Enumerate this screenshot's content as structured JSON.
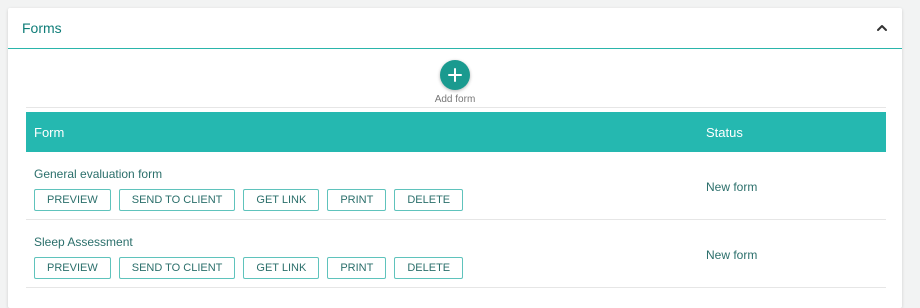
{
  "panel": {
    "title": "Forms"
  },
  "add_form": {
    "label": "Add form"
  },
  "table": {
    "columns": [
      "Form",
      "Status"
    ],
    "rows": [
      {
        "name": "General evaluation form",
        "status": "New form",
        "actions": [
          "PREVIEW",
          "SEND TO CLIENT",
          "GET LINK",
          "PRINT",
          "DELETE"
        ]
      },
      {
        "name": "Sleep Assessment",
        "status": "New form",
        "actions": [
          "PREVIEW",
          "SEND TO CLIENT",
          "GET LINK",
          "PRINT",
          "DELETE"
        ]
      }
    ]
  },
  "icons": {
    "collapse": "chevron-up-icon",
    "add": "plus-icon"
  },
  "colors": {
    "accent": "#25b8b0",
    "accent_dark": "#1a9a8f",
    "text": "#2b6f6b"
  }
}
